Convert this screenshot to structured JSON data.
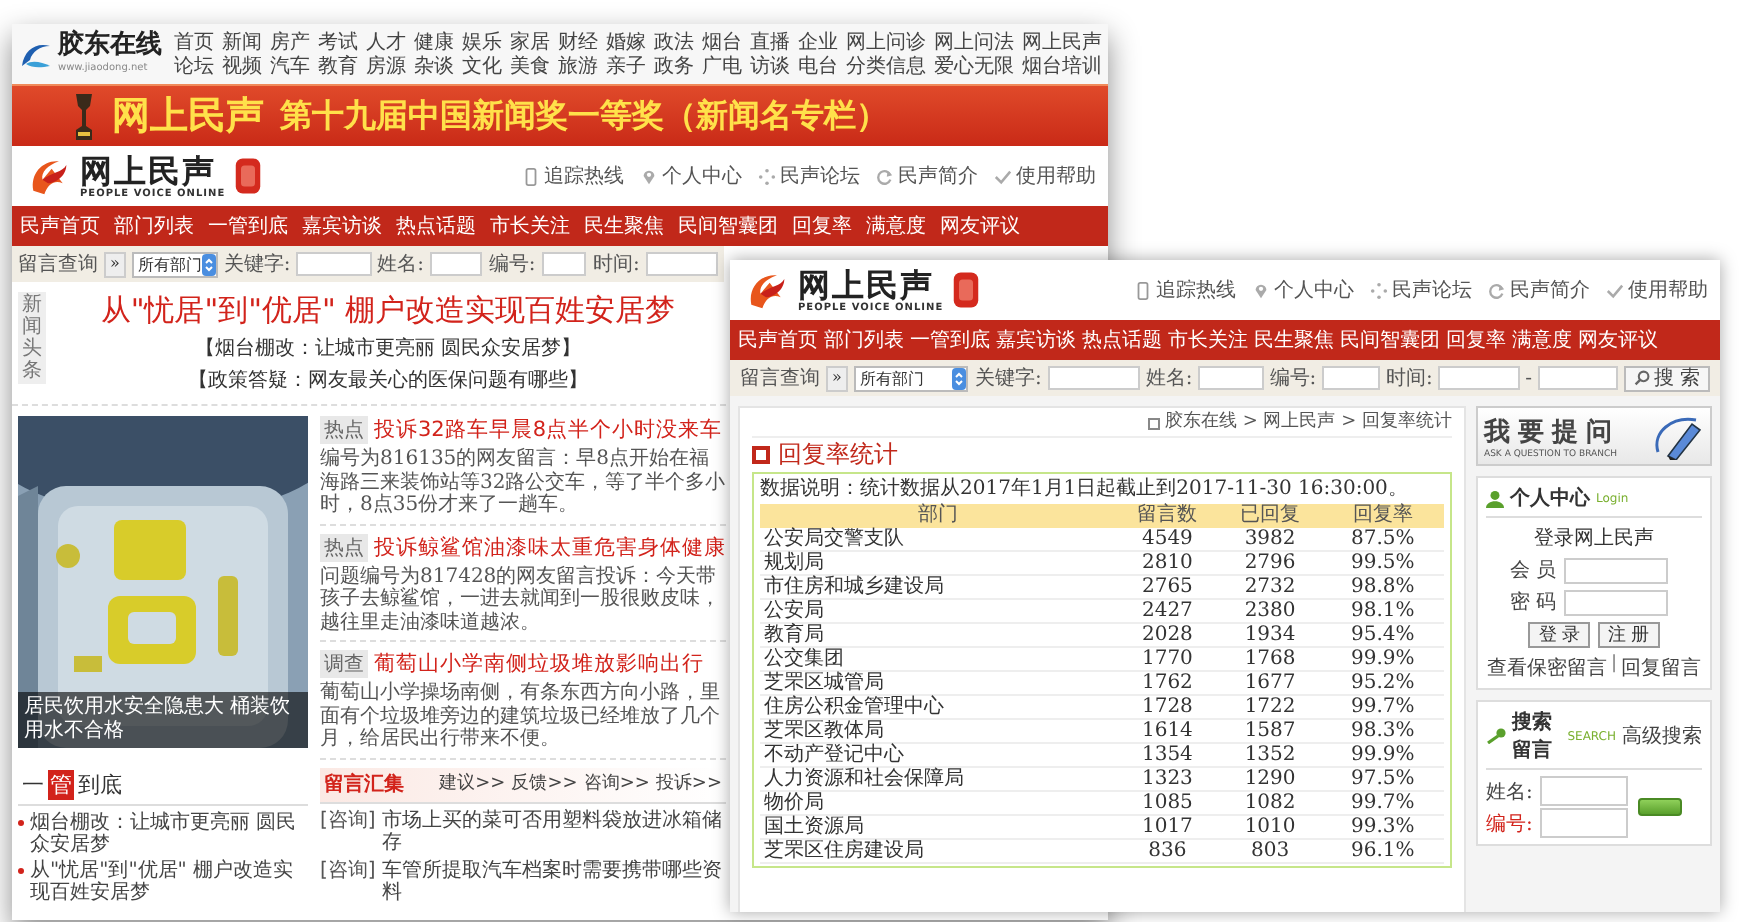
{
  "back_page": {
    "portal_header": {
      "logo": "胶东在线",
      "logo_url": "www.jiaodong.net",
      "nav_rows": [
        [
          "首页",
          "新闻",
          "房产",
          "考试",
          "人才",
          "健康",
          "娱乐",
          "家居",
          "财经",
          "婚嫁",
          "政法",
          "烟台",
          "直播",
          "企业",
          "网上问诊",
          "网上问法",
          "网上民声"
        ],
        [
          "论坛",
          "视频",
          "汽车",
          "教育",
          "房源",
          "杂谈",
          "文化",
          "美食",
          "旅游",
          "亲子",
          "政务",
          "广电",
          "访谈",
          "电台",
          "分类信息",
          "爱心无限",
          "烟台培训"
        ]
      ]
    },
    "banner": {
      "title": "网上民声",
      "text": "第十九届中国新闻奖一等奖（新闻名专栏）"
    },
    "site_header": {
      "title": "网上民声",
      "subtitle": "PEOPLE VOICE ONLINE",
      "links": [
        "追踪热线",
        "个人中心",
        "民声论坛",
        "民声简介",
        "使用帮助"
      ]
    },
    "nav": [
      "民声首页",
      "部门列表",
      "一管到底",
      "嘉宾访谈",
      "热点话题",
      "市长关注",
      "民生聚焦",
      "民间智囊团",
      "回复率",
      "满意度",
      "网友评议"
    ],
    "search": {
      "label": "留言查询",
      "toggle": "»",
      "department": "所有部门",
      "fields": [
        "关键字:",
        "姓名:",
        "编号:",
        "时间:"
      ]
    },
    "headline": {
      "tag": "新闻头条",
      "title": "从\"忧居\"到\"优居\" 棚户改造实现百姓安居梦",
      "links": [
        "【烟台棚改：让城市更亮丽 圆民众安居梦】",
        "【政策答疑：网友最关心的医保问题有哪些】"
      ]
    },
    "photo": {
      "kind": "picture",
      "caption": "居民饮用水安全隐患大 桶装饮用水不合格"
    },
    "news": [
      {
        "tag": "热点",
        "title": "投诉32路车早晨8点半个小时没来车",
        "summary": "编号为816135的网友留言：早8点开始在福海路三来装饰站等32路公交车，等了半个多小时，8点35份才来了一趟车。"
      },
      {
        "tag": "热点",
        "title": "投诉鲸鲨馆油漆味太重危害身体健康",
        "summary": "问题编号为817428的网友留言投诉：今天带孩子去鲸鲨馆，一进去就闻到一股很败皮味，越往里走油漆味道越浓。"
      },
      {
        "tag": "调查",
        "title": "葡萄山小学南侧垃圾堆放影响出行",
        "summary": "葡萄山小学操场南侧，有条东西方向小路，里面有个垃圾堆旁边的建筑垃圾已经堆放了几个月，给居民出行带来不便。"
      }
    ],
    "section": {
      "title_start": "一",
      "title_badge": "管",
      "title_end": "到底",
      "items": [
        "烟台棚改：让城市更亮丽 圆民众安居梦",
        "从\"忧居\"到\"优居\" 棚户改造实现百姓安居梦"
      ]
    },
    "messages": {
      "title": "留言汇集",
      "links": [
        "建议>>",
        "反馈>>",
        "咨询>>",
        "投诉>>"
      ],
      "items": [
        {
          "category": "[咨询]",
          "text": "市场上买的菜可否用塑料袋放进冰箱储存"
        },
        {
          "category": "[咨询]",
          "text": "车管所提取汽车档案时需要携带哪些资料"
        }
      ]
    }
  },
  "front_page": {
    "site_header": {
      "title": "网上民声",
      "subtitle": "PEOPLE VOICE ONLINE",
      "links": [
        "追踪热线",
        "个人中心",
        "民声论坛",
        "民声简介",
        "使用帮助"
      ]
    },
    "nav": [
      "民声首页",
      "部门列表",
      "一管到底",
      "嘉宾访谈",
      "热点话题",
      "市长关注",
      "民生聚焦",
      "民间智囊团",
      "回复率",
      "满意度",
      "网友评议"
    ],
    "search": {
      "label": "留言查询",
      "toggle": "»",
      "department": "所有部门",
      "fields": [
        "关键字:",
        "姓名:",
        "编号:",
        "时间:"
      ],
      "range_separator": "-",
      "button": "搜 索"
    },
    "breadcrumb": "胶东在线 > 网上民声 > 回复率统计",
    "title": "回复率统计",
    "note": "数据说明：统计数据从2017年1月1日起截止到2017-11-30 16:30:00。",
    "table": {
      "columns": [
        "部门",
        "留言数",
        "已回复",
        "回复率"
      ],
      "rows": [
        [
          "公安局交警支队",
          "4549",
          "3982",
          "87.5%"
        ],
        [
          "规划局",
          "2810",
          "2796",
          "99.5%"
        ],
        [
          "市住房和城乡建设局",
          "2765",
          "2732",
          "98.8%"
        ],
        [
          "公安局",
          "2427",
          "2380",
          "98.1%"
        ],
        [
          "教育局",
          "2028",
          "1934",
          "95.4%"
        ],
        [
          "公交集团",
          "1770",
          "1768",
          "99.9%"
        ],
        [
          "芝罘区城管局",
          "1762",
          "1677",
          "95.2%"
        ],
        [
          "住房公积金管理中心",
          "1728",
          "1722",
          "99.7%"
        ],
        [
          "芝罘区教体局",
          "1614",
          "1587",
          "98.3%"
        ],
        [
          "不动产登记中心",
          "1354",
          "1352",
          "99.9%"
        ],
        [
          "人力资源和社会保障局",
          "1323",
          "1290",
          "97.5%"
        ],
        [
          "物价局",
          "1085",
          "1082",
          "99.7%"
        ],
        [
          "国土资源局",
          "1017",
          "1010",
          "99.3%"
        ],
        [
          "芝罘区住房建设局",
          "836",
          "803",
          "96.1%"
        ]
      ]
    },
    "ask": {
      "title": "我要提问",
      "subtitle": "ASK A QUESTION TO BRANCH"
    },
    "login": {
      "title": "个人中心",
      "subtitle": "Login",
      "heading": "登录网上民声",
      "fields": [
        "会 员",
        "密 码"
      ],
      "buttons": [
        "登 录",
        "注 册"
      ],
      "links": [
        "查看保密留言",
        "回复留言"
      ],
      "separator": "|"
    },
    "message_search": {
      "title": "搜索留言",
      "subtitle": "SEARCH",
      "advanced": "高级搜索",
      "fields": [
        {
          "label": "姓名:",
          "required": false
        },
        {
          "label": "编号:",
          "required": true
        }
      ]
    }
  }
}
